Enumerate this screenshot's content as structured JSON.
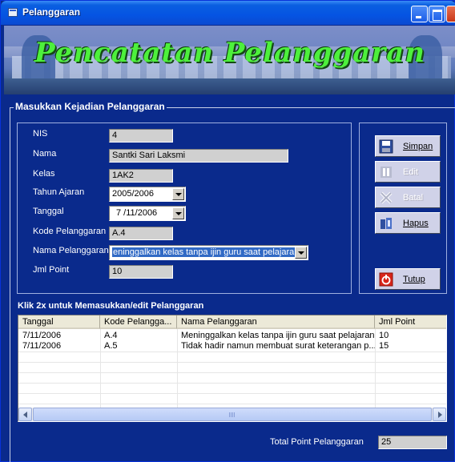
{
  "window": {
    "title": "Pelanggaran"
  },
  "banner": {
    "title": "Pencatatan Pelanggaran"
  },
  "form": {
    "group_label": "Masukkan  Kejadian Pelanggaran",
    "fields": {
      "nis": {
        "label": "NIS",
        "value": "4"
      },
      "nama": {
        "label": "Nama",
        "value": "Santki Sari Laksmi"
      },
      "kelas": {
        "label": "Kelas",
        "value": "1AK2"
      },
      "tahun_ajaran": {
        "label": "Tahun Ajaran",
        "value": "2005/2006"
      },
      "tanggal": {
        "label": "Tanggal",
        "value": "7 /11/2006"
      },
      "kode_pelanggaran": {
        "label": "Kode Pelanggaran",
        "value": "A.4"
      },
      "nama_pelanggaran": {
        "label": "Nama Pelanggaran",
        "value": "eninggalkan kelas tanpa ijin guru saat pelajaran"
      },
      "jml_point": {
        "label": "Jml Point",
        "value": "10"
      }
    }
  },
  "buttons": {
    "simpan": {
      "label": "Simpan",
      "enabled": true,
      "icon": "floppy-disk-icon"
    },
    "edit": {
      "label": "Edit",
      "enabled": false,
      "icon": "edit-icon"
    },
    "batal": {
      "label": "Batal",
      "enabled": false,
      "icon": "cancel-x-icon"
    },
    "hapus": {
      "label": "Hapus",
      "enabled": true,
      "icon": "delete-files-icon"
    },
    "tutup": {
      "label": "Tutup",
      "enabled": true,
      "icon": "power-icon"
    }
  },
  "list": {
    "caption": "Klik 2x untuk Memasukkan/edit Pelanggaran",
    "columns": [
      "Tanggal",
      "Kode Pelangga...",
      "Nama Pelanggaran",
      "Jml Point"
    ],
    "rows": [
      [
        "7/11/2006",
        "A.4",
        "Meninggalkan kelas tanpa ijin guru saat pelajaran",
        "10"
      ],
      [
        "7/11/2006",
        "A.5",
        "Tidak hadir namun membuat surat keterangan p...",
        "15"
      ]
    ]
  },
  "total": {
    "label": "Total Point Pelanggaran",
    "value": "25"
  },
  "colors": {
    "window_bg": "#0a2a8c",
    "banner_text": "#4df03c",
    "selection": "#316ac5"
  }
}
